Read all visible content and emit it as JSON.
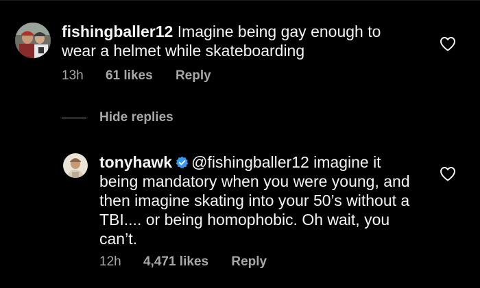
{
  "colors": {
    "background": "#000000",
    "text": "#f5f5f5",
    "secondary": "#a8a8a8",
    "verified": "#3897f0"
  },
  "comment": {
    "username": "fishingballer12",
    "text": "Imagine being gay enough to wear a helmet while skateboarding",
    "time": "13h",
    "likes": "61 likes",
    "reply_label": "Reply",
    "like_icon": "heart-outline-icon",
    "avatar": "user-avatar"
  },
  "hide_replies_label": "Hide replies",
  "reply": {
    "username": "tonyhawk",
    "verified_icon": "verified-badge-icon",
    "mention": "@fishingballer12",
    "text": "imagine it being mandatory when you were young, and then imagine skating into your 50’s without a TBI.... or being homophobic. Oh wait, you can’t.",
    "time": "12h",
    "likes": "4,471 likes",
    "reply_label": "Reply",
    "like_icon": "heart-outline-icon",
    "avatar": "user-avatar"
  }
}
